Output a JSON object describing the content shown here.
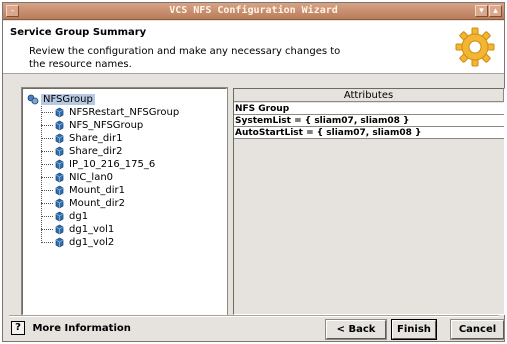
{
  "window": {
    "title": "VCS NFS Configuration Wizard",
    "menu_glyph": "-",
    "minimize_glyph": "▾",
    "maximize_glyph": "▴"
  },
  "header": {
    "title": "Service Group Summary",
    "description": "Review the configuration and make any necessary changes to the resource names.",
    "icon": "gear-icon"
  },
  "tree": {
    "root": {
      "label": "NFSGroup",
      "icon": "service-group-icon"
    },
    "children": [
      {
        "label": "NFSRestart_NFSGroup",
        "icon": "resource-icon"
      },
      {
        "label": "NFS_NFSGroup",
        "icon": "resource-icon"
      },
      {
        "label": "Share_dir1",
        "icon": "resource-icon"
      },
      {
        "label": "Share_dir2",
        "icon": "resource-icon"
      },
      {
        "label": "IP_10_216_175_6",
        "icon": "resource-icon"
      },
      {
        "label": "NIC_lan0",
        "icon": "resource-icon"
      },
      {
        "label": "Mount_dir1",
        "icon": "resource-icon"
      },
      {
        "label": "Mount_dir2",
        "icon": "resource-icon"
      },
      {
        "label": "dg1",
        "icon": "resource-icon"
      },
      {
        "label": "dg1_vol1",
        "icon": "resource-icon"
      },
      {
        "label": "dg1_vol2",
        "icon": "resource-icon"
      }
    ]
  },
  "attributes": {
    "header": "Attributes",
    "rows": [
      "NFS Group",
      "SystemList = { sliam07, sliam08 }",
      "AutoStartList = { sliam07, sliam08 }"
    ]
  },
  "footer": {
    "more_info_label": "More Information",
    "more_info_icon": "?",
    "back_label": "< Back",
    "finish_label": "Finish",
    "cancel_label": "Cancel"
  },
  "colors": {
    "titlebar": "#c48a68",
    "window_bg": "#e6e3df",
    "selection": "#b7c9e2",
    "resource_icon": "#2f6fb0"
  }
}
